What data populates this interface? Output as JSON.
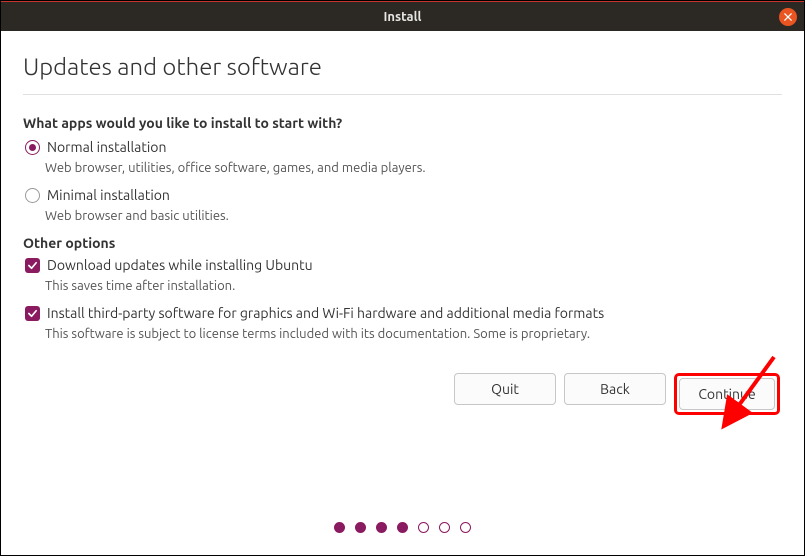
{
  "titlebar": {
    "title": "Install"
  },
  "page": {
    "heading": "Updates and other software"
  },
  "apps": {
    "question": "What apps would you like to install to start with?",
    "normal": {
      "label": "Normal installation",
      "desc": "Web browser, utilities, office software, games, and media players."
    },
    "minimal": {
      "label": "Minimal installation",
      "desc": "Web browser and basic utilities."
    }
  },
  "other": {
    "label": "Other options",
    "updates": {
      "label": "Download updates while installing Ubuntu",
      "desc": "This saves time after installation."
    },
    "thirdparty": {
      "label": "Install third-party software for graphics and Wi-Fi hardware and additional media formats",
      "desc": "This software is subject to license terms included with its documentation. Some is proprietary."
    }
  },
  "buttons": {
    "quit": "Quit",
    "back": "Back",
    "continue": "Continue"
  },
  "progress": {
    "total": 7,
    "current": 4
  }
}
